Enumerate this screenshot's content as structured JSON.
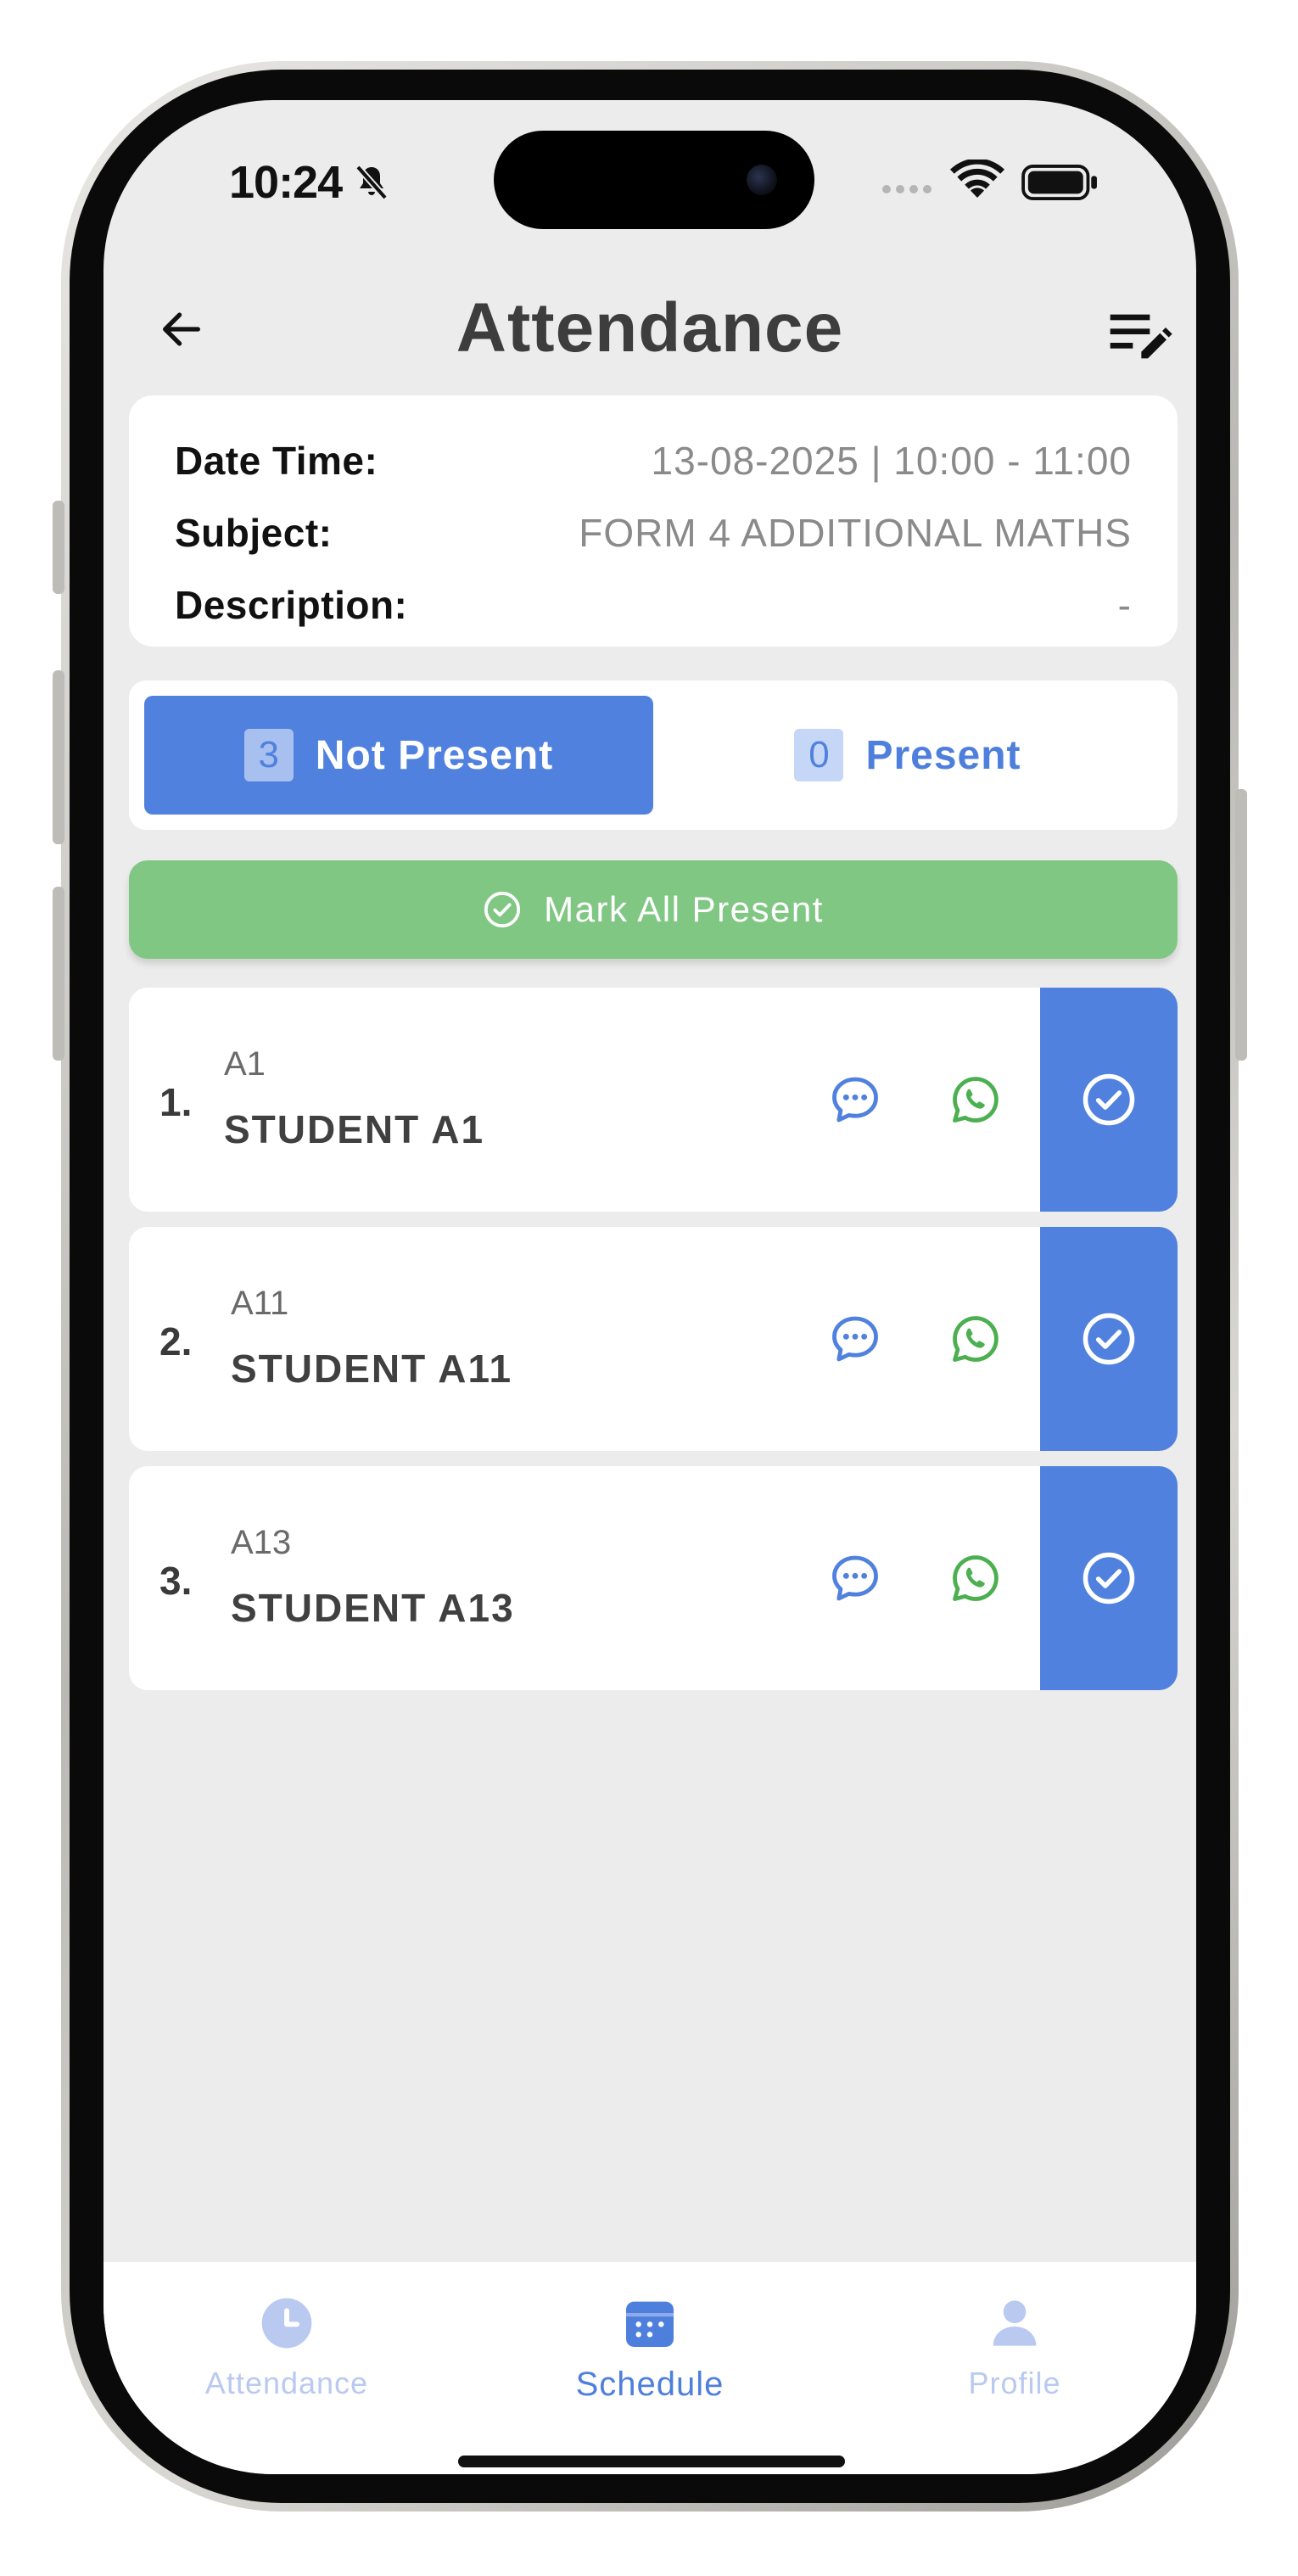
{
  "status_bar": {
    "time": "10:24"
  },
  "header": {
    "title": "Attendance"
  },
  "info": {
    "rows": [
      {
        "label": "Date Time:",
        "value": "13-08-2025 | 10:00 - 11:00"
      },
      {
        "label": "Subject:",
        "value": "FORM 4 ADDITIONAL MATHS"
      },
      {
        "label": "Description:",
        "value": "-"
      }
    ]
  },
  "tabs": {
    "not_present": {
      "count": "3",
      "label": "Not Present"
    },
    "present": {
      "count": "0",
      "label": "Present"
    }
  },
  "mark_all": {
    "label": "Mark All Present"
  },
  "students": [
    {
      "index": "1.",
      "id": "A1",
      "name": "STUDENT A1"
    },
    {
      "index": "2.",
      "id": "A11",
      "name": "STUDENT A11"
    },
    {
      "index": "3.",
      "id": "A13",
      "name": "STUDENT A13"
    }
  ],
  "bottom_nav": {
    "items": [
      {
        "label": "Attendance",
        "icon": "clock-icon"
      },
      {
        "label": "Schedule",
        "icon": "calendar-icon"
      },
      {
        "label": "Profile",
        "icon": "person-icon"
      }
    ],
    "active": "Schedule"
  },
  "colors": {
    "primary": "#5181de",
    "success": "#81c784",
    "whatsapp": "#4caf50",
    "background": "#ececec"
  }
}
